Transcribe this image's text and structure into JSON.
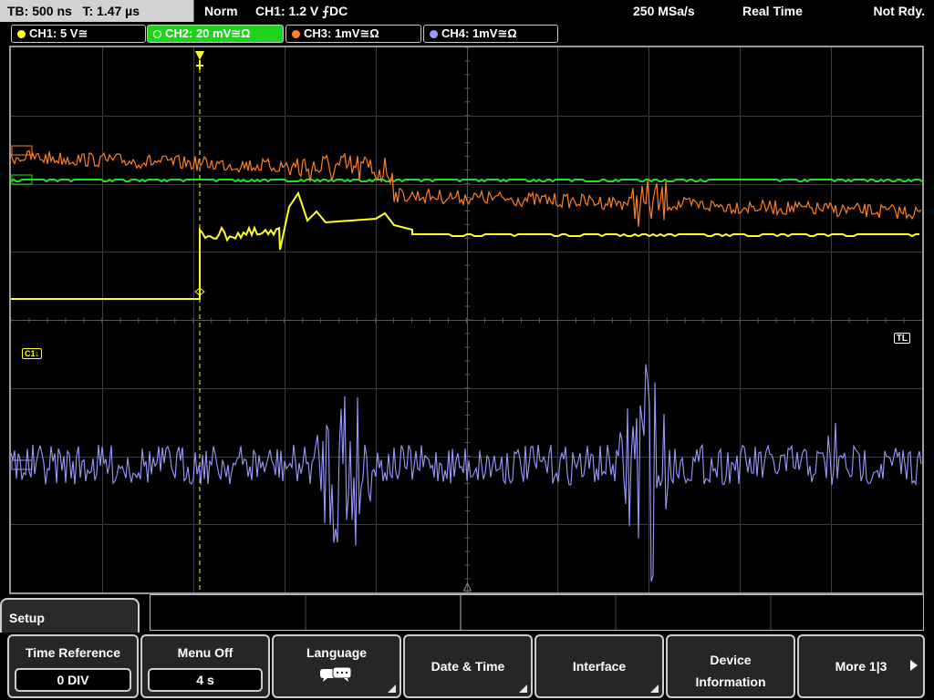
{
  "status": {
    "timebase": "TB: 500 ns",
    "time_offset": "T: 1.47 µs",
    "trigger_mode": "Norm",
    "trigger": "CH1: 1.2 V ⨍DC",
    "sample_rate": "250 MSa/s",
    "acquisition": "Real Time",
    "state": "Not Rdy."
  },
  "channels": [
    {
      "label": "CH1: 5 V≅",
      "color": "#ffff20",
      "active": false
    },
    {
      "label": "CH2: 20 mV≅Ω",
      "color": "#20e020",
      "active": true
    },
    {
      "label": "CH3: 1mV≅Ω",
      "color": "#ff8020",
      "active": false
    },
    {
      "label": "CH4: 1mV≅Ω",
      "color": "#9a9aff",
      "active": false
    }
  ],
  "screen_markers": {
    "ch1": "C1↓",
    "trigger_level": "TL"
  },
  "menu": {
    "title": "Setup",
    "time_reference": {
      "label": "Time Reference",
      "value": "0 DIV"
    },
    "menu_off": {
      "label": "Menu Off",
      "value": "4 s"
    },
    "language": {
      "label": "Language",
      "icon": "speech-bubbles-icon"
    },
    "date_time": {
      "label": "Date & Time"
    },
    "interface": {
      "label": "Interface"
    },
    "device_information": {
      "label_line1": "Device",
      "label_line2": "Information"
    },
    "more": {
      "label": "More 1|3"
    }
  },
  "colors": {
    "ch1": "#ffff20",
    "ch2": "#20e020",
    "ch3": "#ff8020",
    "ch4": "#9a9aff",
    "grid": "#3c3c3c"
  }
}
